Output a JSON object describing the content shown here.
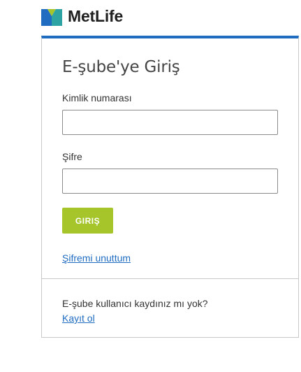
{
  "brand": {
    "name": "MetLife",
    "logo_icon": "metlife-logo-icon",
    "colors": {
      "logo_blue": "#1f6cc1",
      "logo_green": "#a5c52b",
      "logo_teal": "#2ea3a3"
    }
  },
  "login_card": {
    "title": "E-şube'ye Giriş",
    "accent_color": "#1f6cc1",
    "id_label": "Kimlik numarası",
    "id_value": "",
    "password_label": "Şifre",
    "password_value": "",
    "login_button_label": "GIRIŞ",
    "login_button_color": "#a5c52b",
    "forgot_password_link": "Şifremi unuttum",
    "register_prompt": "E-şube kullanıcı kaydınız mı yok?",
    "register_link": "Kayıt ol",
    "link_color": "#1f6cc1"
  }
}
